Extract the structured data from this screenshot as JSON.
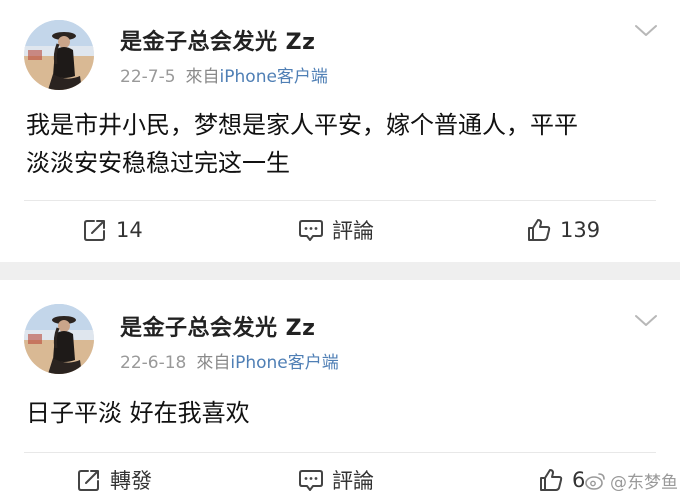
{
  "posts": [
    {
      "user_name": "是金子总会发光 Zz",
      "date": "22-7-5",
      "source_prefix": "來自",
      "source_device": "iPhone客户端",
      "content_line1": "我是市井小民，梦想是家人平安，嫁个普通人，平平",
      "content_line2": "淡淡安安稳稳过完这一生",
      "repost_label": "14",
      "comment_label": "評論",
      "like_count": "139",
      "icons": {
        "repost": "repost-icon",
        "comment": "comment-icon",
        "like": "thumbs-up-icon",
        "menu": "chevron-down-icon"
      }
    },
    {
      "user_name": "是金子总会发光 Zz",
      "date": "22-6-18",
      "source_prefix": "來自",
      "source_device": "iPhone客户端",
      "content_line1": "日子平淡 好在我喜欢",
      "repost_label": "轉發",
      "comment_label": "評論",
      "like_count": "6",
      "icons": {
        "repost": "repost-icon",
        "comment": "comment-icon",
        "like": "thumbs-up-icon",
        "menu": "chevron-down-icon"
      }
    }
  ],
  "watermark": {
    "text": "@东梦鱼",
    "icon": "weibo-logo-icon"
  },
  "colors": {
    "device_link": "#4f7fb5",
    "meta_gray": "#999999",
    "separator": "#efefef"
  }
}
